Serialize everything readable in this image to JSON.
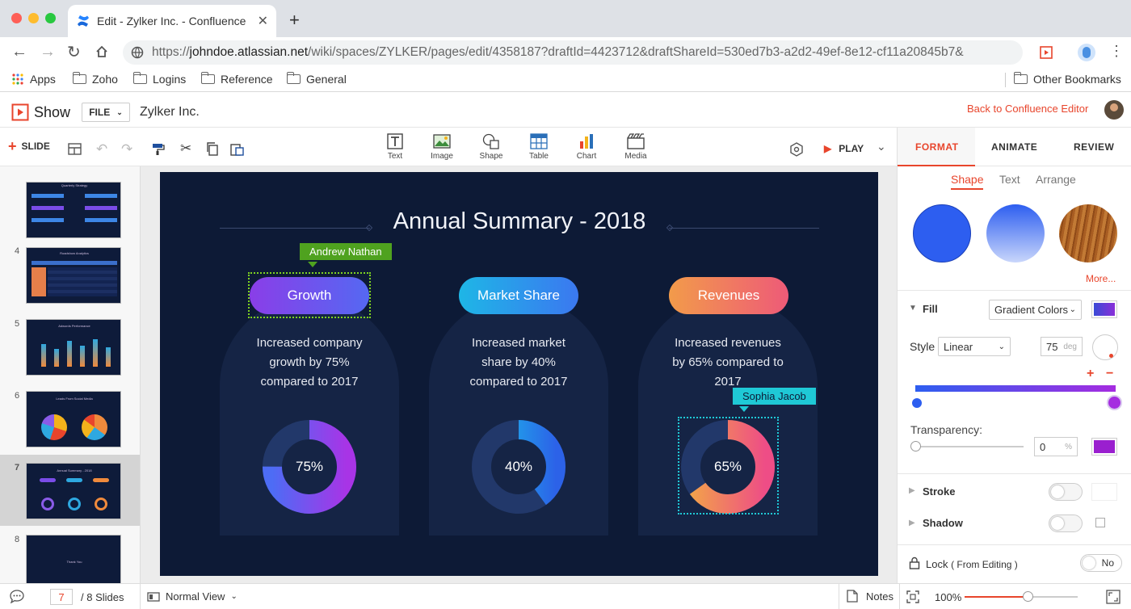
{
  "browser": {
    "tab_title": "Edit - Zylker Inc. - Confluence",
    "url_prefix": "https://",
    "url_host": "johndoe.atlassian.net",
    "url_path": "/wiki/spaces/ZYLKER/pages/edit/4358187?draftId=4423712&draftShareId=530ed7b3-a2d2-49ef-8e12-cf11a20845b7&",
    "bookmarks": [
      "Apps",
      "Zoho",
      "Logins",
      "Reference",
      "General"
    ],
    "other_bookmarks": "Other Bookmarks"
  },
  "app": {
    "name": "Show",
    "file_menu": "FILE",
    "doc_title": "Zylker Inc.",
    "back_link": "Back to Confluence Editor"
  },
  "toolbar": {
    "slide_label": "SLIDE",
    "insert_items": [
      "Text",
      "Image",
      "Shape",
      "Table",
      "Chart",
      "Media"
    ],
    "play_label": "PLAY"
  },
  "thumbnails": [
    {
      "num": "",
      "title": "Quarterly Strategy"
    },
    {
      "num": "4",
      "title": "Roadshow Analytics"
    },
    {
      "num": "5",
      "title": "Adwords Performance"
    },
    {
      "num": "6",
      "title": "Leads From Social Media"
    },
    {
      "num": "7",
      "title": "Annual Summary - 2018"
    },
    {
      "num": "8",
      "title": "Thank You"
    }
  ],
  "slide": {
    "title": "Annual Summary - 2018",
    "cards": [
      {
        "pill": "Growth",
        "text": [
          "Increased company",
          "growth by 75%",
          "compared to 2017"
        ],
        "percent": "75%",
        "value": 0.75
      },
      {
        "pill": "Market Share",
        "text": [
          "Increased market",
          "share by 40%",
          "compared to 2017"
        ],
        "percent": "40%",
        "value": 0.4
      },
      {
        "pill": "Revenues",
        "text": [
          "Increased revenues",
          "by 65% compared to",
          "2017"
        ],
        "percent": "65%",
        "value": 0.65
      }
    ],
    "collaborators": [
      "Andrew Nathan",
      "Sophia Jacob"
    ],
    "colors": {
      "bg": "#0d1a36",
      "card": "#152445",
      "growth_tag": "#4fa21f",
      "sophia_tag": "#1fc9d6"
    }
  },
  "format_panel": {
    "tabs": [
      "FORMAT",
      "ANIMATE",
      "REVIEW"
    ],
    "subtabs": [
      "Shape",
      "Text",
      "Arrange"
    ],
    "more": "More...",
    "fill_label": "Fill",
    "fill_type": "Gradient Colors",
    "style_label": "Style",
    "style_value": "Linear",
    "angle": "75",
    "angle_unit": "deg",
    "transparency_label": "Transparency:",
    "transparency_value": "0",
    "transparency_unit": "%",
    "stroke_label": "Stroke",
    "shadow_label": "Shadow",
    "lock_label": "Lock",
    "lock_sub": "( From Editing )",
    "lock_toggle": "No",
    "accent": "#e8452c"
  },
  "status": {
    "current_slide": "7",
    "total_slides": "/ 8 Slides",
    "view_mode": "Normal View",
    "notes": "Notes",
    "zoom": "100%"
  }
}
